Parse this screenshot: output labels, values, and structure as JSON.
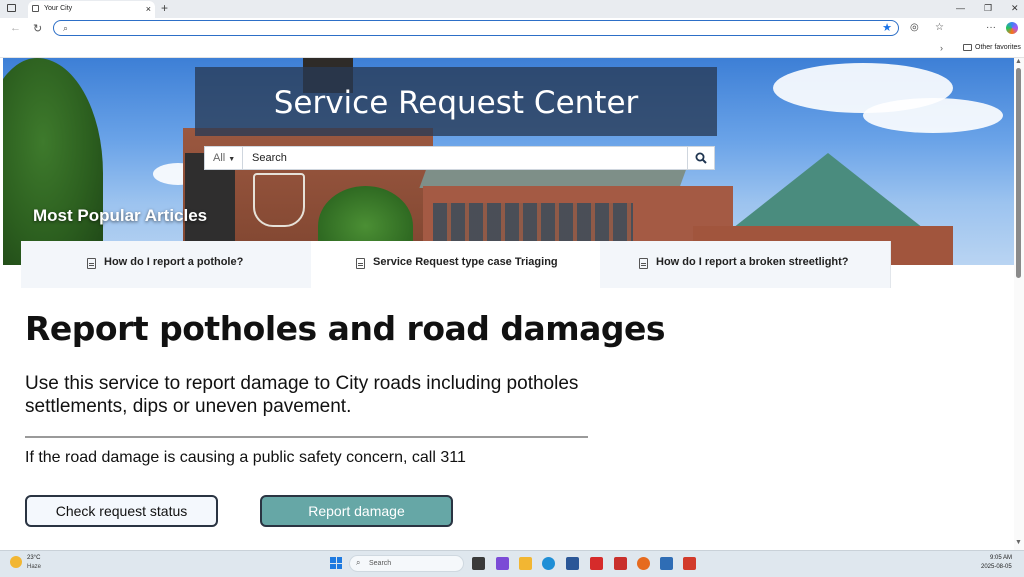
{
  "browser": {
    "tab_title": "Your City",
    "tab_close": "×",
    "new_tab": "+",
    "address_value": "",
    "favorites_label": "Other favorites",
    "window_min": "—",
    "window_max": "❐",
    "window_close": "✕",
    "back": "←",
    "reload": "↻",
    "more": "···",
    "chevron": "›"
  },
  "hero": {
    "title": "Service Request Center",
    "search_scope": "All",
    "search_placeholder": "Search",
    "popular_label": "Most Popular Articles"
  },
  "articles": [
    {
      "label": "How do I report a pothole?",
      "icon": "document-icon"
    },
    {
      "label": "Service Request type case Triaging",
      "icon": "document-icon"
    },
    {
      "label": "How do I report a broken streetlight?",
      "icon": "document-icon"
    }
  ],
  "main": {
    "heading": "Report potholes and road damages",
    "description": "Use this service to report damage to City roads including potholes settlements, dips or uneven pavement.",
    "safety_note": "If the road damage is causing a public safety concern, call 311",
    "check_status_label": "Check request status",
    "report_label": "Report damage"
  },
  "taskbar": {
    "temperature": "23°C",
    "weather": "Haze",
    "search_label": "Search",
    "time": "9:05 AM",
    "date": "2025-08-05"
  },
  "colors": {
    "title_overlay": "#283a54",
    "report_button": "#66a7a6",
    "address_border": "#2d6fc7"
  }
}
